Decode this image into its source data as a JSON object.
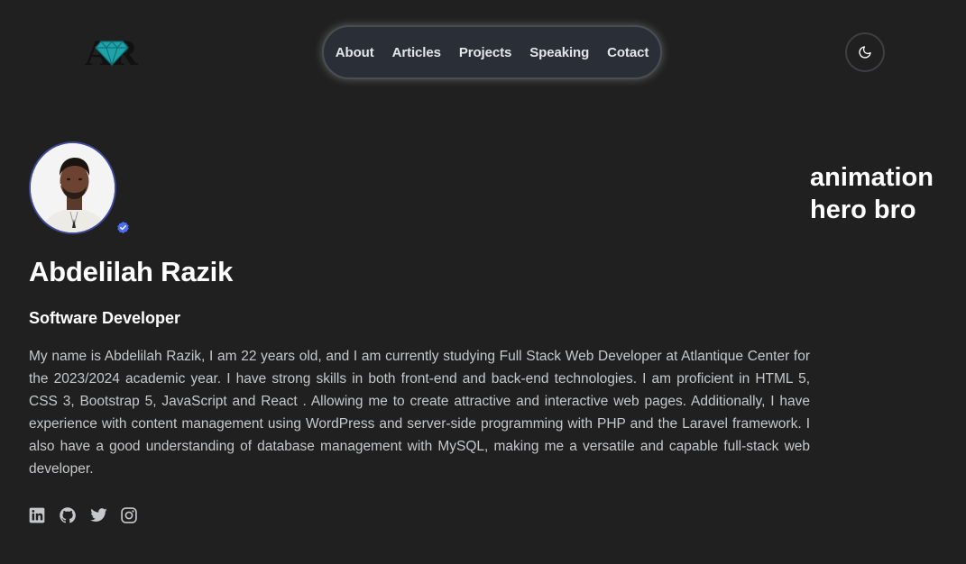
{
  "header": {
    "logo": {
      "text": "AR",
      "icon": "diamond-icon"
    },
    "nav": [
      {
        "label": "About"
      },
      {
        "label": "Articles"
      },
      {
        "label": "Projects"
      },
      {
        "label": "Speaking"
      },
      {
        "label": "Cotact"
      }
    ],
    "theme_toggle": {
      "icon": "moon-icon"
    }
  },
  "hero": {
    "name": "Abdelilah Razik",
    "role": "Software Developer",
    "bio": "My name is Abdelilah Razik, I am 22 years old, and I am currently studying Full Stack Web Developer at Atlantique Center for the 2023/2024 academic year. I have strong skills in both front-end and back-end technologies. I am proficient in HTML 5, CSS 3, Bootstrap 5, JavaScript and React . Allowing me to create attractive and interactive web pages. Additionally, I have experience with content management using WordPress and server-side programming with PHP and the Laravel framework. I also have a good understanding of database management with MySQL, making me a versatile and capable full-stack web developer.",
    "animation_placeholder": [
      "animation",
      "hero bro"
    ],
    "avatar": {
      "verified_icon": "verified-badge-icon"
    },
    "socials": [
      {
        "icon": "linkedin-icon"
      },
      {
        "icon": "github-icon"
      },
      {
        "icon": "twitter-icon"
      },
      {
        "icon": "instagram-icon"
      }
    ]
  },
  "colors": {
    "background": "#1f201f",
    "nav_bg": "#2a2e36",
    "text": "#ffffff",
    "body_text": "#c6c8cc",
    "accent": "#4c6ef5",
    "logo_teal": "#1fa3a8"
  }
}
